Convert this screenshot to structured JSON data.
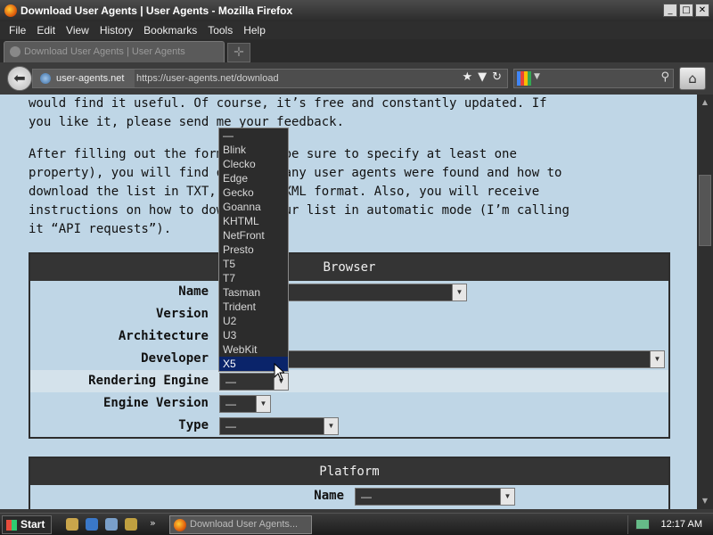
{
  "window": {
    "title": "Download User Agents | User Agents - Mozilla Firefox",
    "buttons": [
      "_",
      "□",
      "✕"
    ]
  },
  "menubar": [
    "File",
    "Edit",
    "View",
    "History",
    "Bookmarks",
    "Tools",
    "Help"
  ],
  "tabs": [
    {
      "label": "Download User Agents | User Agents"
    }
  ],
  "nav": {
    "site_badge": "user-agents.net",
    "url": "https://user-agents.net/download"
  },
  "page": {
    "para1": "would find it useful. Of course, it’s free and constantly updated. If\nyou like it, please send me your feedback.",
    "para2": "After filling out the form below (be sure to specify at least one\nproperty), you will find out how many user agents were found and how to\ndownload the list in TXT, JSON or XML format. Also, you will receive\ninstructions on how to download your list in automatic mode (I’m calling\nit “API requests”).",
    "browser": {
      "heading": "Browser",
      "fields": [
        {
          "label": "Name",
          "value": ""
        },
        {
          "label": "Version",
          "value": ""
        },
        {
          "label": "Architecture",
          "value": ""
        },
        {
          "label": "Developer",
          "value": ""
        },
        {
          "label": "Rendering Engine",
          "value": "—"
        },
        {
          "label": "Engine Version",
          "value": "—"
        },
        {
          "label": "Type",
          "value": "—"
        }
      ]
    },
    "platform": {
      "heading": "Platform",
      "fields": [
        {
          "label": "Name",
          "value": "—"
        }
      ]
    }
  },
  "dropdown": {
    "options": [
      "—",
      "Blink",
      "Clecko",
      "Edge",
      "Gecko",
      "Goanna",
      "KHTML",
      "NetFront",
      "Presto",
      "T5",
      "T7",
      "Tasman",
      "Trident",
      "U2",
      "U3",
      "WebKit",
      "X5"
    ],
    "highlighted_index": 16
  },
  "taskbar": {
    "start": "Start",
    "task": "Download User Agents...",
    "clock": "12:17 AM"
  }
}
